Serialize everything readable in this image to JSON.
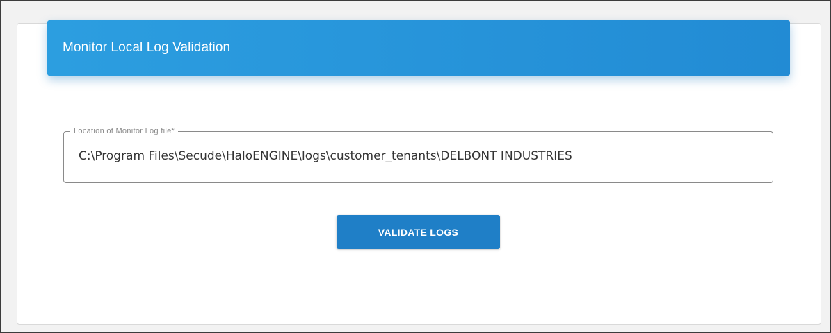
{
  "card": {
    "title": "Monitor Local Log Validation"
  },
  "log_location": {
    "label": "Location of Monitor Log file*",
    "value": "C:\\Program Files\\Secude\\HaloENGINE\\logs\\customer_tenants\\DELBONT INDUSTRIES"
  },
  "actions": {
    "validate_label": "VALIDATE LOGS"
  },
  "colors": {
    "header_gradient_start": "#2c9ee0",
    "header_gradient_end": "#228bd4",
    "button": "#1f7fc7",
    "field_border": "#8a8a8a",
    "page_background": "#f2f2f2"
  }
}
